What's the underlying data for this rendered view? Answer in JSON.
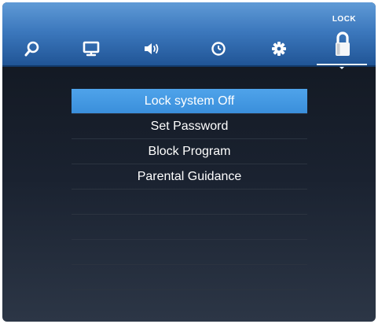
{
  "header": {
    "active_tab_caption": "LOCK",
    "tabs": [
      {
        "icon": "search-icon"
      },
      {
        "icon": "monitor-icon"
      },
      {
        "icon": "speaker-icon"
      },
      {
        "icon": "clock-icon"
      },
      {
        "icon": "gear-icon"
      },
      {
        "icon": "padlock-icon",
        "active": true
      }
    ]
  },
  "menu": {
    "items": [
      {
        "label": "Lock system Off",
        "selected": true
      },
      {
        "label": "Set Password"
      },
      {
        "label": "Block Program"
      },
      {
        "label": "Parental Guidance"
      }
    ]
  },
  "colors": {
    "header_top": "#5f9ad6",
    "header_bottom": "#1f5394",
    "selection": "#3a8fdb",
    "background": "#1a2230",
    "text": "#ffffff"
  }
}
